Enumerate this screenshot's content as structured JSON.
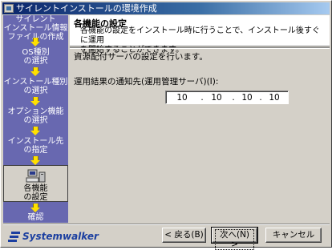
{
  "window": {
    "title": "サイレントインストールの環境作成"
  },
  "sidebar": {
    "steps": [
      {
        "label_lines": [
          "サイレント",
          "インストール情報",
          "ファイルの作成"
        ]
      },
      {
        "label_lines": [
          "OS種別",
          "の選択"
        ]
      },
      {
        "label_lines": [
          "インストール種別",
          "の選択"
        ]
      },
      {
        "label_lines": [
          "オプション機能",
          "の選択"
        ]
      },
      {
        "label_lines": [
          "インストール先",
          "の指定"
        ]
      },
      {
        "label_lines": [
          "各機能",
          "の設定"
        ]
      },
      {
        "label_lines": [
          "確認"
        ]
      }
    ],
    "active_step": 5
  },
  "header": {
    "title": "各機能の設定",
    "description_lines": [
      "各機能の設定をインストール時に行うことで、インストール後すぐに運用",
      "を開始することができます。"
    ]
  },
  "main": {
    "intro": "資源配付サーバの設定を行います。",
    "field_label": "運用結果の通知先(運用管理サーバ)(I):",
    "ip": [
      "10",
      "10",
      "10",
      "10"
    ],
    "ip_separator": "."
  },
  "footer": {
    "logo_text": "Systemwalker",
    "back_label": "< 戻る(B)",
    "next_label": "次へ(N) >",
    "cancel_label": "キャンセル"
  },
  "colors": {
    "sidebar_bg": "#6868b0",
    "arrow": "#ffe000",
    "logo": "#1b3fa0"
  }
}
